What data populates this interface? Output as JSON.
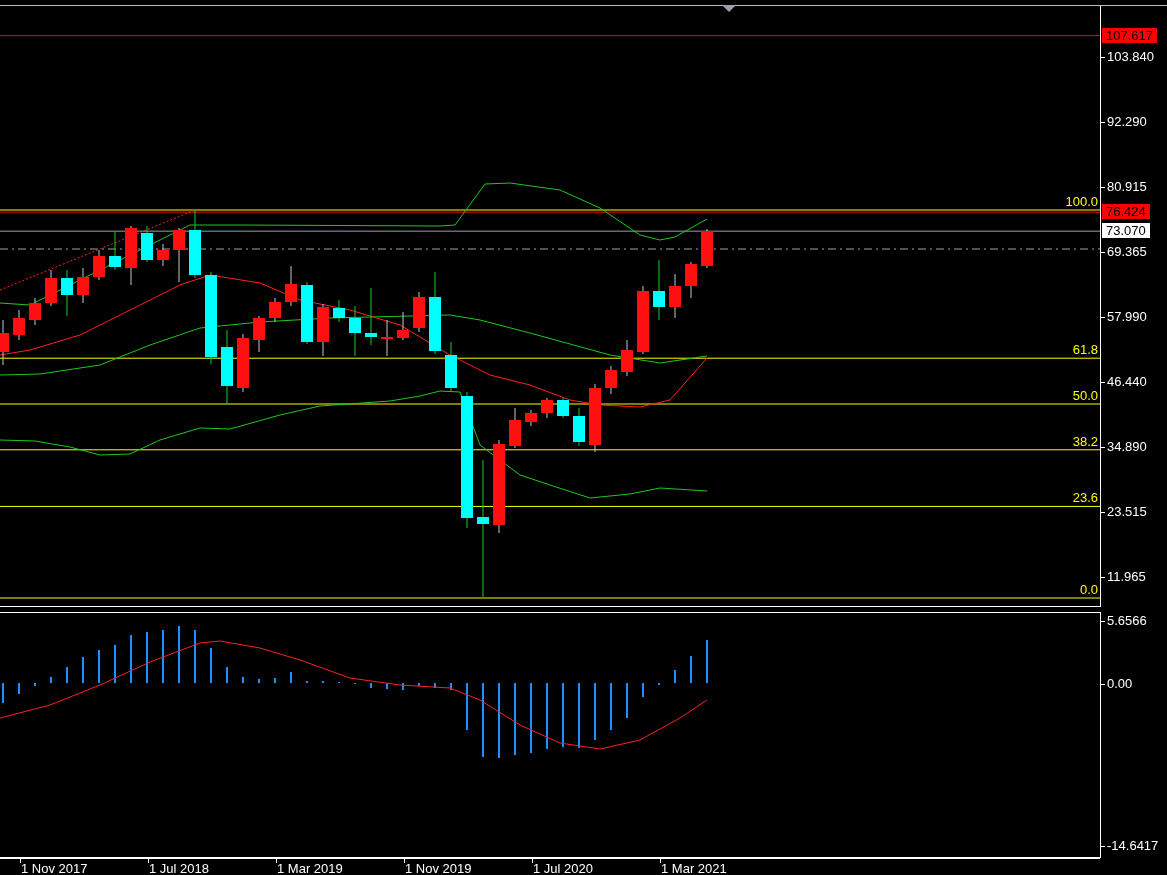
{
  "price_axis": {
    "ticks": [
      "103.840",
      "92.290",
      "80.915",
      "69.365",
      "57.990",
      "46.440",
      "34.890",
      "23.515",
      "11.965"
    ]
  },
  "price_tags": [
    {
      "label": "107.617",
      "color": "#ff0000"
    },
    {
      "label": "76.424",
      "color": "#ff0000"
    },
    {
      "label": "73.070",
      "color": "#ffffff"
    }
  ],
  "fibonacci_levels": [
    {
      "label": "100.0"
    },
    {
      "label": "61.8"
    },
    {
      "label": "50.0"
    },
    {
      "label": "38.2"
    },
    {
      "label": "23.6"
    },
    {
      "label": "0.0"
    }
  ],
  "indicator_axis": {
    "ticks": [
      "5.6566",
      "0.00",
      "-14.6417"
    ]
  },
  "time_axis": {
    "ticks": [
      "1 Nov 2017",
      "1 Jul 2018",
      "1 Mar 2019",
      "1 Nov 2019",
      "1 Jul 2020",
      "1 Mar 2021"
    ]
  }
}
